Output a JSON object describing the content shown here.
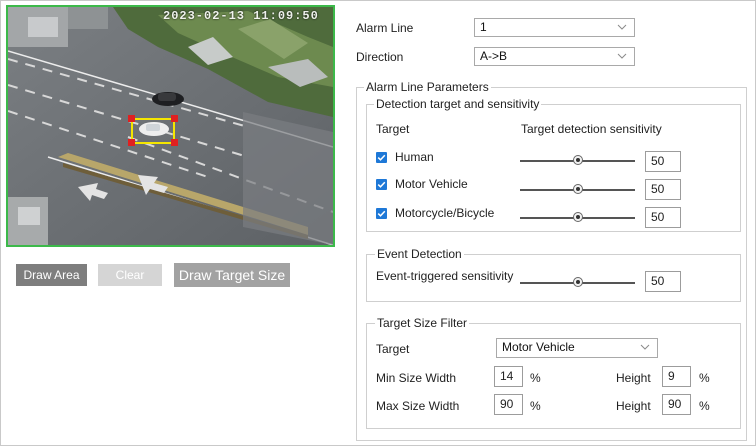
{
  "preview": {
    "timestamp": "2023-02-13 11:09:50"
  },
  "buttons": {
    "draw_area": "Draw Area",
    "clear": "Clear",
    "draw_target_size": "Draw Target Size"
  },
  "alarm_line": {
    "label": "Alarm Line",
    "value": "1"
  },
  "direction": {
    "label": "Direction",
    "value": "A->B"
  },
  "parameters": {
    "legend": "Alarm Line Parameters",
    "detection": {
      "legend": "Detection target and sensitivity",
      "col_target": "Target",
      "col_sensitivity": "Target detection sensitivity",
      "rows": [
        {
          "label": "Human",
          "checked": true,
          "sensitivity": 50
        },
        {
          "label": "Motor Vehicle",
          "checked": true,
          "sensitivity": 50
        },
        {
          "label": "Motorcycle/Bicycle",
          "checked": true,
          "sensitivity": 50
        }
      ]
    },
    "event": {
      "legend": "Event Detection",
      "label": "Event-triggered sensitivity",
      "sensitivity": 50
    },
    "size_filter": {
      "legend": "Target Size Filter",
      "target_label": "Target",
      "target_value": "Motor Vehicle",
      "min_width_label": "Min Size Width",
      "min_width": "14",
      "min_height_label": "Height",
      "min_height": "9",
      "max_width_label": "Max Size Width",
      "max_width": "90",
      "max_height_label": "Height",
      "max_height": "90",
      "unit": "%"
    }
  },
  "colors": {
    "preview_border": "#3cb94a",
    "checkbox": "#1e78d7",
    "target_box": "#f5e600",
    "target_handles": "#e02020"
  }
}
